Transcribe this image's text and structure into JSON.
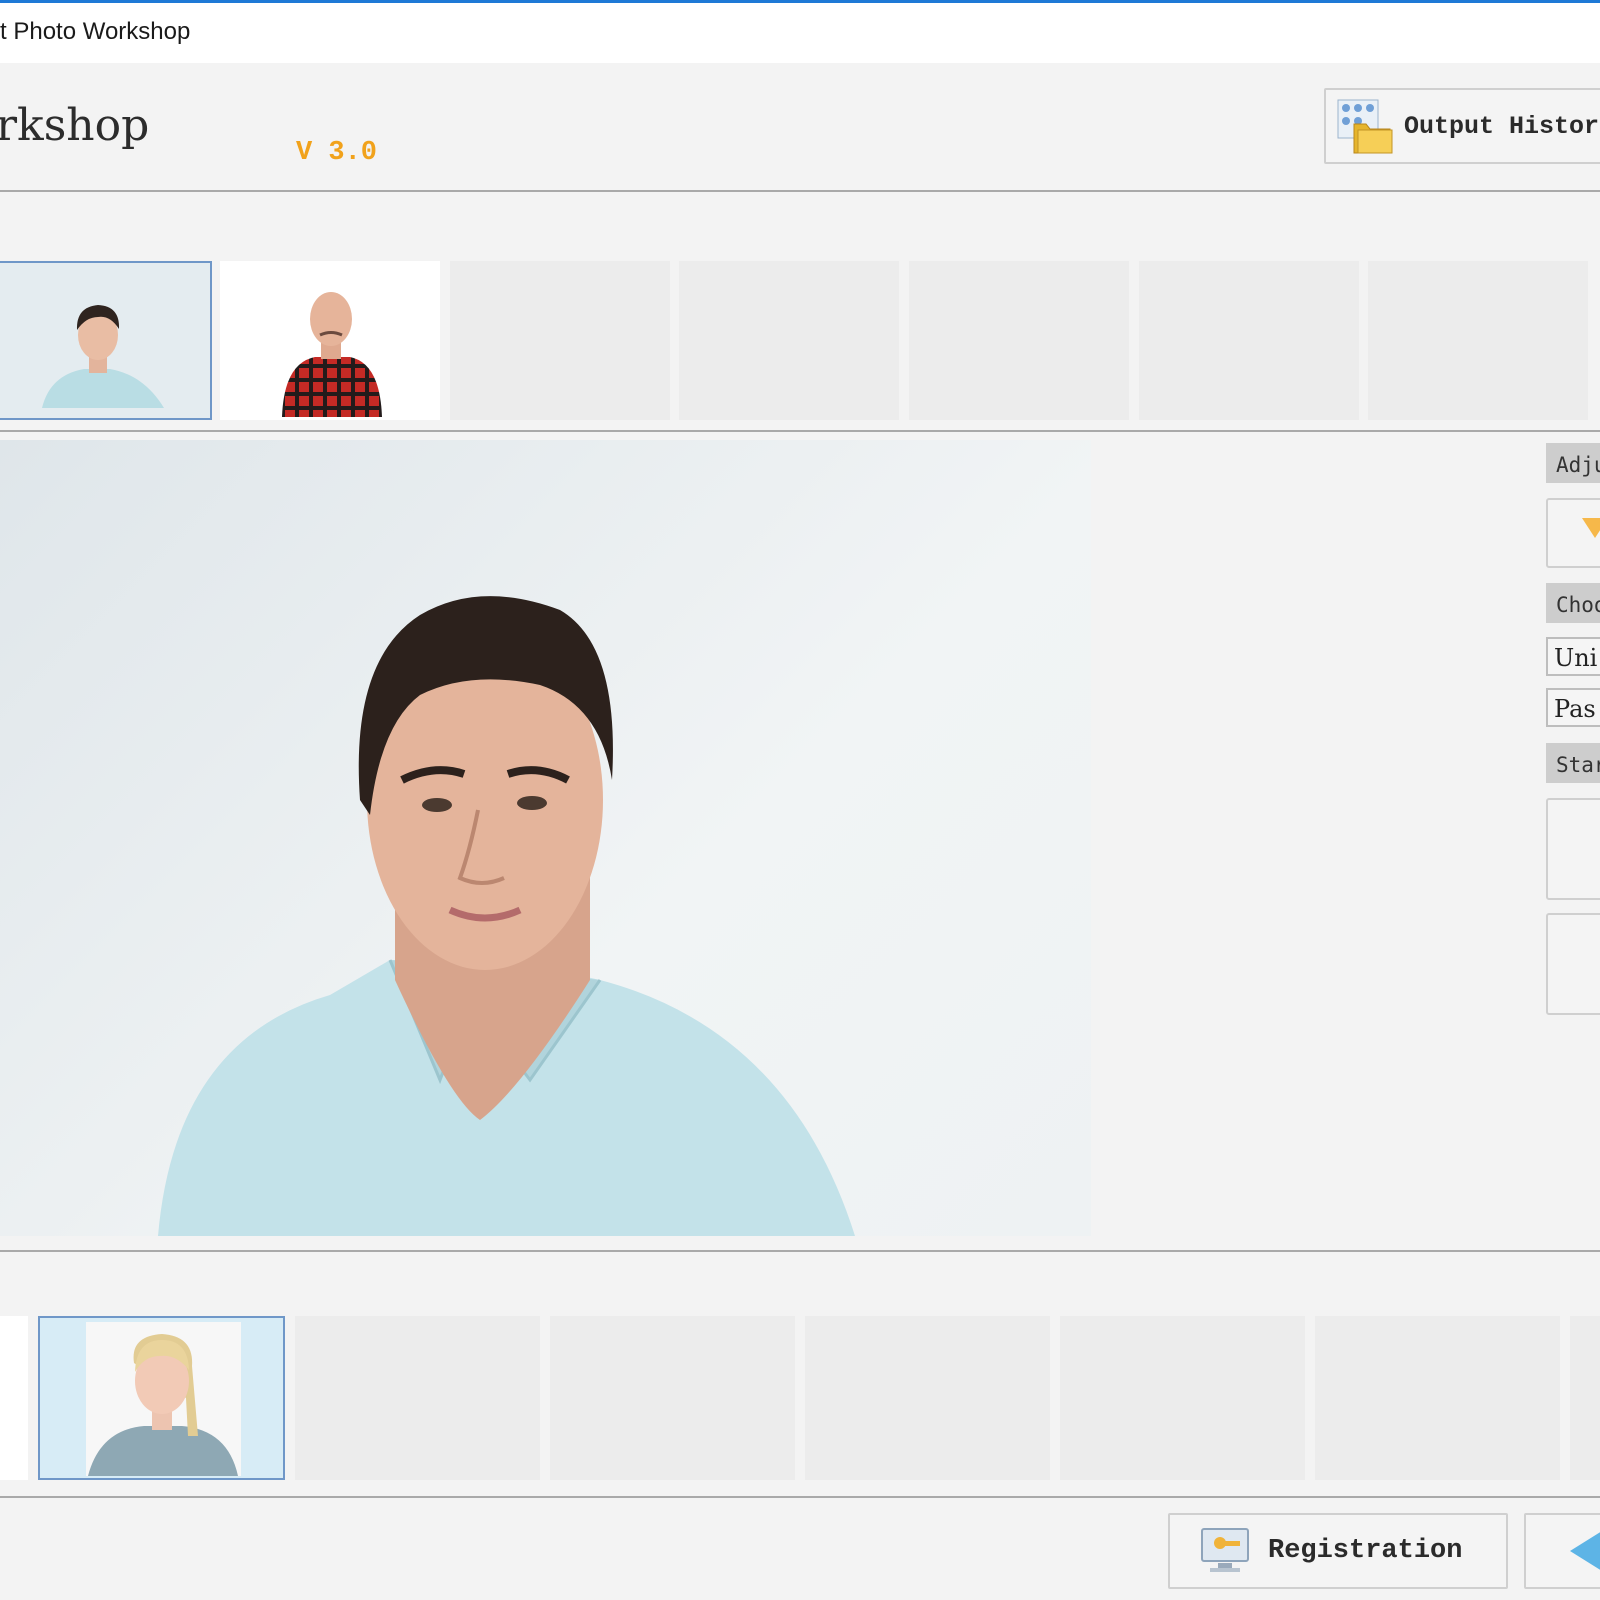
{
  "window": {
    "title": "t Photo Workshop"
  },
  "header": {
    "app_name": "rkshop",
    "version": "V 3.0",
    "output_history_label": "Output Histor"
  },
  "side_panel": {
    "adjust_header": "Adju",
    "choose_header": "Choo",
    "options": [
      "Uni",
      "Pas"
    ],
    "standard_header": "Star"
  },
  "footer": {
    "registration_label": "Registration"
  },
  "colors": {
    "accent": "#1e79d6",
    "version": "#f1a21b",
    "selection": "#d7ecf6"
  }
}
